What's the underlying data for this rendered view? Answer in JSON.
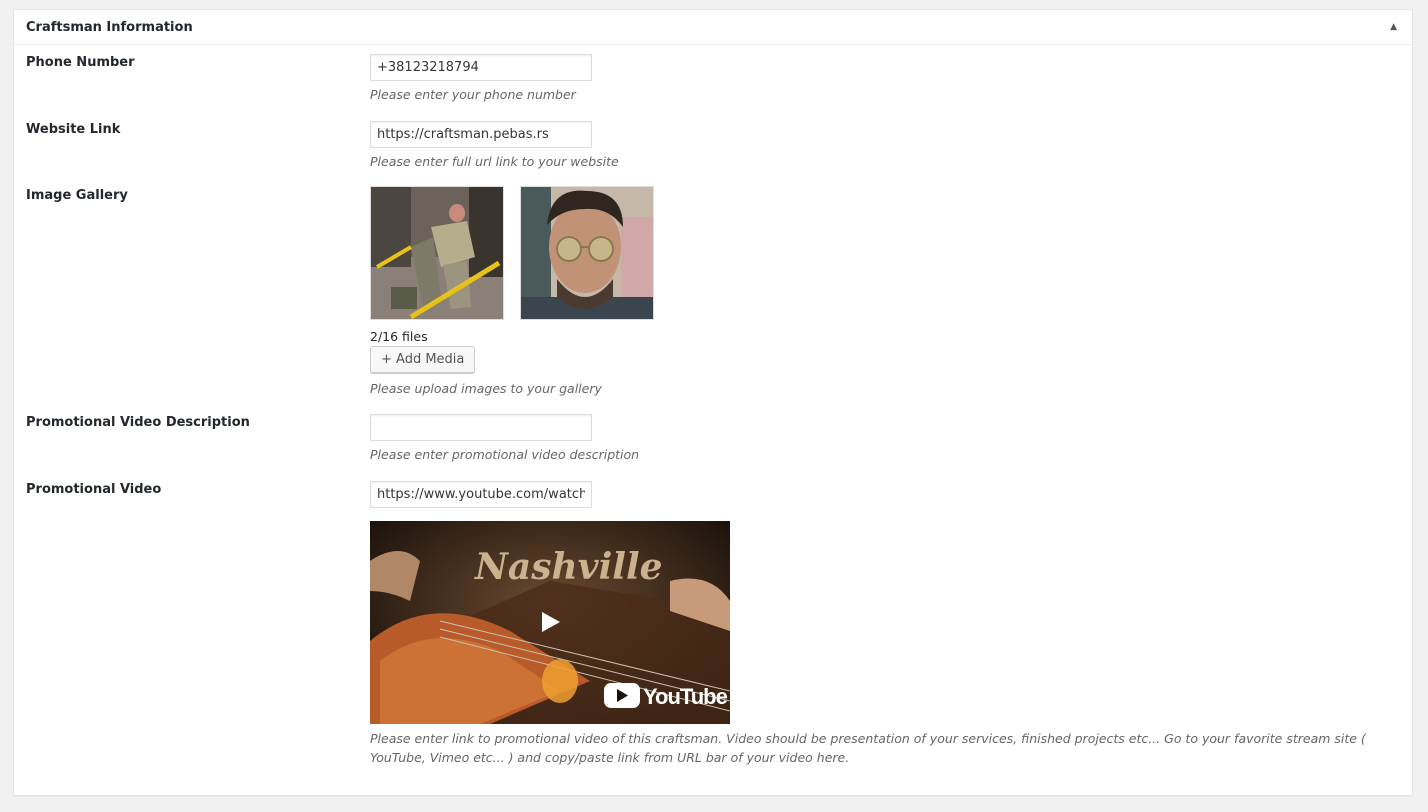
{
  "panel": {
    "title": "Craftsman Information",
    "toggle_icon": "triangle-up-icon"
  },
  "phone": {
    "label": "Phone Number",
    "value": "+38123218794",
    "description": "Please enter your phone number"
  },
  "website": {
    "label": "Website Link",
    "value": "https://craftsman.pebas.rs",
    "description": "Please enter full url link to your website"
  },
  "gallery": {
    "label": "Image Gallery",
    "images": [
      "worker-with-shovel-photo",
      "man-with-sunglasses-photo"
    ],
    "count": "2/16 files",
    "add_button": "+ Add Media",
    "description": "Please upload images to your gallery"
  },
  "video_description": {
    "label": "Promotional Video Description",
    "value": "",
    "description": "Please enter promotional video description"
  },
  "video": {
    "label": "Promotional Video",
    "value": "https://www.youtube.com/watch?v",
    "thumbnail_text": "Nashville",
    "logo_text": "YouTube",
    "description": "Please enter link to promotional video of this craftsman. Video should be presentation of your services, finished projects etc... Go to your favorite stream site ( YouTube, Vimeo etc... ) and copy/paste link from URL bar of your video here."
  },
  "colors": {
    "background": "#f1f1f1",
    "panel": "#ffffff",
    "text": "#23282d",
    "description": "#666666",
    "youtube_red": "#ff0000"
  }
}
